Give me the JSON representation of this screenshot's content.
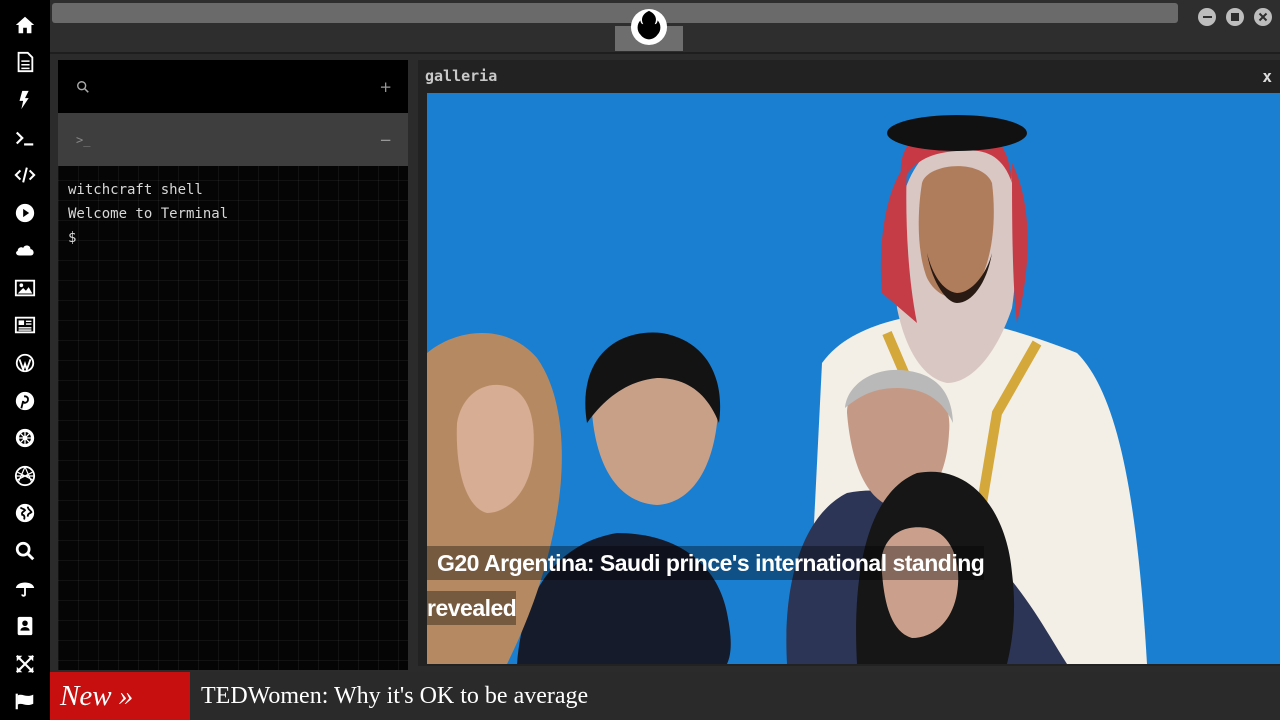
{
  "dock": {
    "items": [
      {
        "name": "home-icon"
      },
      {
        "name": "document-icon"
      },
      {
        "name": "lightning-icon"
      },
      {
        "name": "terminal-icon"
      },
      {
        "name": "code-icon"
      },
      {
        "name": "play-icon"
      },
      {
        "name": "cloud-icon"
      },
      {
        "name": "image-icon"
      },
      {
        "name": "newspaper-icon"
      },
      {
        "name": "wordpress-icon"
      },
      {
        "name": "pinterest-icon"
      },
      {
        "name": "settings-wheel-icon"
      },
      {
        "name": "globe-wire-icon"
      },
      {
        "name": "globe-icon"
      },
      {
        "name": "search-icon"
      },
      {
        "name": "umbrella-icon"
      },
      {
        "name": "contacts-icon"
      },
      {
        "name": "expand-icon"
      },
      {
        "name": "flag-icon"
      }
    ]
  },
  "topbar": {
    "logo": "rebel-alliance-icon"
  },
  "terminal": {
    "tab_prompt": ">_",
    "add_label": "+",
    "collapse_label": "−",
    "lines": [
      "witchcraft shell",
      "Welcome to Terminal",
      "$"
    ]
  },
  "galleria": {
    "title": "galleria",
    "close_label": "x",
    "caption_line1": "G20 Argentina: Saudi prince's international standing",
    "caption_line2": "revealed"
  },
  "ticker": {
    "badge": "New »",
    "headline": "TEDWomen: Why it's OK to be average"
  },
  "colors": {
    "accent_red": "#c80f0f",
    "photo_blue": "#1a7fd0"
  }
}
